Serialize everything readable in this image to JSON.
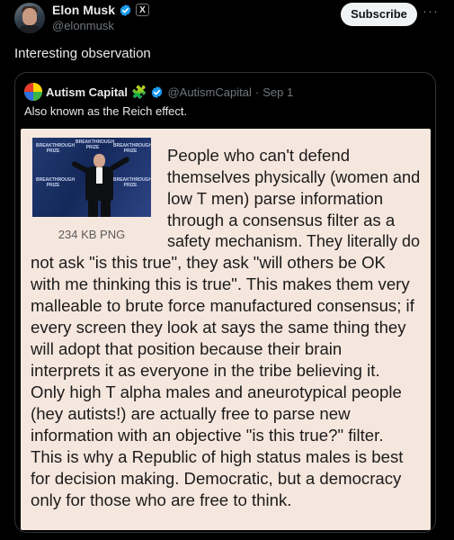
{
  "author": {
    "display_name": "Elon Musk",
    "handle": "@elonmusk",
    "x_badge": "X",
    "avatar": "elon-musk-avatar"
  },
  "actions": {
    "subscribe_label": "Subscribe",
    "more_label": "···"
  },
  "post": {
    "text": "Interesting observation"
  },
  "quote": {
    "display_name": "Autism Capital",
    "emoji": "🧩",
    "handle": "@AutismCapital",
    "separator": "·",
    "date": "Sep 1",
    "text": "Also known as the Reich effect."
  },
  "meme": {
    "file_label": "234 KB PNG",
    "photo_logo_text": "BREAKTHROUGH PRIZE",
    "lines": [
      "People who can't defend",
      "themselves physically (women and",
      "low T men) parse information",
      "through a consensus filter as a",
      "safety mechanism. They literally do",
      "not ask \"is this true\", they ask \"will others be OK",
      "with me thinking this is true\". This makes them very",
      "malleable to brute force manufactured consensus; if",
      "every screen they look at says the same thing they",
      "will adopt that position because their brain",
      "interprets it as everyone in the tribe believing it.",
      "Only high T alpha males and aneurotypical people",
      "(hey autists!) are actually free to parse new",
      "information with an objective \"is this true?\" filter.",
      "This is why a Republic of high status males is best",
      "for decision making. Democratic, but a democracy",
      "only for those who are free to think."
    ]
  },
  "colors": {
    "background": "#000000",
    "text": "#e7e9ea",
    "muted": "#71767b",
    "verified_blue": "#1d9bf0",
    "meme_background": "#f6e7de"
  }
}
